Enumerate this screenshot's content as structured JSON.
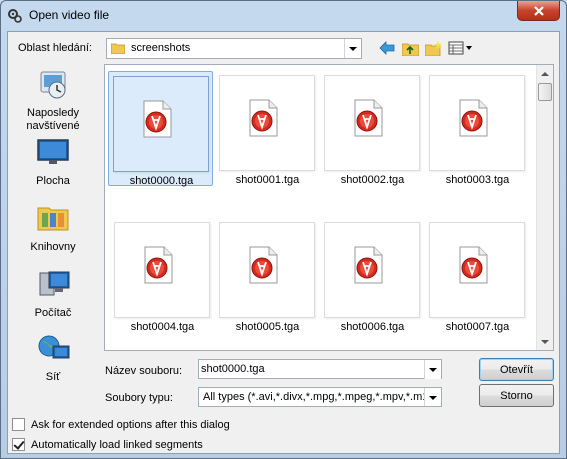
{
  "window": {
    "title": "Open video file"
  },
  "lookin": {
    "label": "Oblast hledání:",
    "value": "screenshots"
  },
  "places": [
    {
      "label": "Naposledy\nnavštívené",
      "icon": "recent-places-icon"
    },
    {
      "label": "Plocha",
      "icon": "desktop-icon"
    },
    {
      "label": "Knihovny",
      "icon": "libraries-icon"
    },
    {
      "label": "Počítač",
      "icon": "computer-icon"
    },
    {
      "label": "Síť",
      "icon": "network-icon"
    }
  ],
  "files": [
    {
      "name": "shot0000.tga",
      "selected": true
    },
    {
      "name": "shot0001.tga"
    },
    {
      "name": "shot0002.tga"
    },
    {
      "name": "shot0003.tga"
    },
    {
      "name": "shot0004.tga"
    },
    {
      "name": "shot0005.tga"
    },
    {
      "name": "shot0006.tga"
    },
    {
      "name": "shot0007.tga"
    }
  ],
  "filename": {
    "label": "Název souboru:",
    "value": "shot0000.tga"
  },
  "filetype": {
    "label": "Soubory typu:",
    "value": "All types (*.avi,*.divx,*.mpg,*.mpeg,*.mpv,*.m1v"
  },
  "buttons": {
    "open": "Otevřít",
    "cancel": "Storno"
  },
  "options": {
    "extended": {
      "label": "Ask for extended options after this dialog",
      "checked": false
    },
    "linked": {
      "label": "Automatically load linked segments",
      "checked": true
    }
  },
  "colors": {
    "selection": "#dcebfc",
    "close": "#c7432c",
    "file_icon_red": "#d42a1f"
  }
}
